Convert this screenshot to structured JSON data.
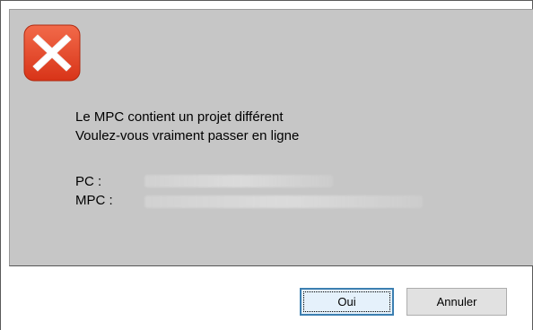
{
  "dialog": {
    "icon": "error-x-icon",
    "message_line1": "Le MPC contient un projet différent",
    "message_line2": "Voulez-vous vraiment passer en ligne",
    "pc_label": "PC  :",
    "mpc_label": "MPC :",
    "buttons": {
      "yes_label": "Oui",
      "cancel_label": "Annuler"
    }
  },
  "colors": {
    "content_background": "#c6c6c6",
    "icon_red": "#e8462a",
    "default_button_border": "#3c7fb1"
  }
}
